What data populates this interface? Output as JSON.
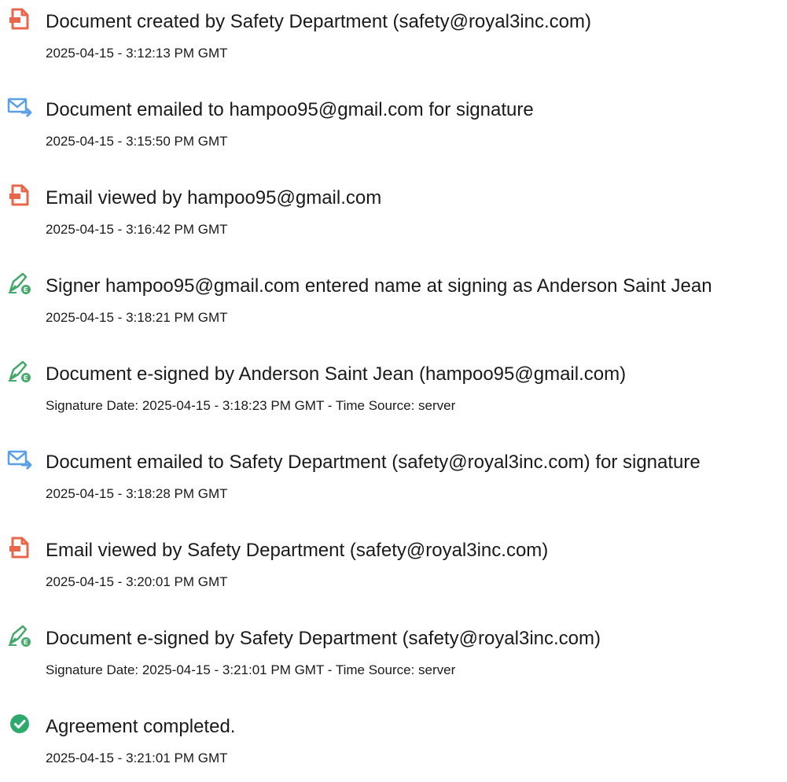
{
  "colors": {
    "document_icon": "#e8674a",
    "email_icon": "#5aa0e6",
    "sign_icon": "#44a96a",
    "complete_icon": "#2eaa6e"
  },
  "events": [
    {
      "icon": "document-icon",
      "title": "Document created by Safety Department (safety@royal3inc.com)",
      "meta": "2025-04-15 - 3:12:13 PM GMT"
    },
    {
      "icon": "email-send-icon",
      "title": "Document emailed to hampoo95@gmail.com for signature",
      "meta": "2025-04-15 - 3:15:50 PM GMT"
    },
    {
      "icon": "document-icon",
      "title": "Email viewed by hampoo95@gmail.com",
      "meta": "2025-04-15 - 3:16:42 PM GMT"
    },
    {
      "icon": "pen-sign-icon",
      "title": "Signer hampoo95@gmail.com entered name at signing as Anderson Saint Jean",
      "meta": "2025-04-15 - 3:18:21 PM GMT"
    },
    {
      "icon": "pen-sign-icon",
      "title": "Document e-signed by Anderson Saint Jean (hampoo95@gmail.com)",
      "meta": "Signature Date: 2025-04-15 - 3:18:23 PM GMT - Time Source: server"
    },
    {
      "icon": "email-send-icon",
      "title": "Document emailed to Safety Department (safety@royal3inc.com) for signature",
      "meta": "2025-04-15 - 3:18:28 PM GMT"
    },
    {
      "icon": "document-icon",
      "title": "Email viewed by Safety Department (safety@royal3inc.com)",
      "meta": "2025-04-15 - 3:20:01 PM GMT"
    },
    {
      "icon": "pen-sign-icon",
      "title": "Document e-signed by Safety Department (safety@royal3inc.com)",
      "meta": "Signature Date: 2025-04-15 - 3:21:01 PM GMT - Time Source: server"
    },
    {
      "icon": "checkmark-icon",
      "title": "Agreement completed.",
      "meta": "2025-04-15 - 3:21:01 PM GMT"
    }
  ]
}
